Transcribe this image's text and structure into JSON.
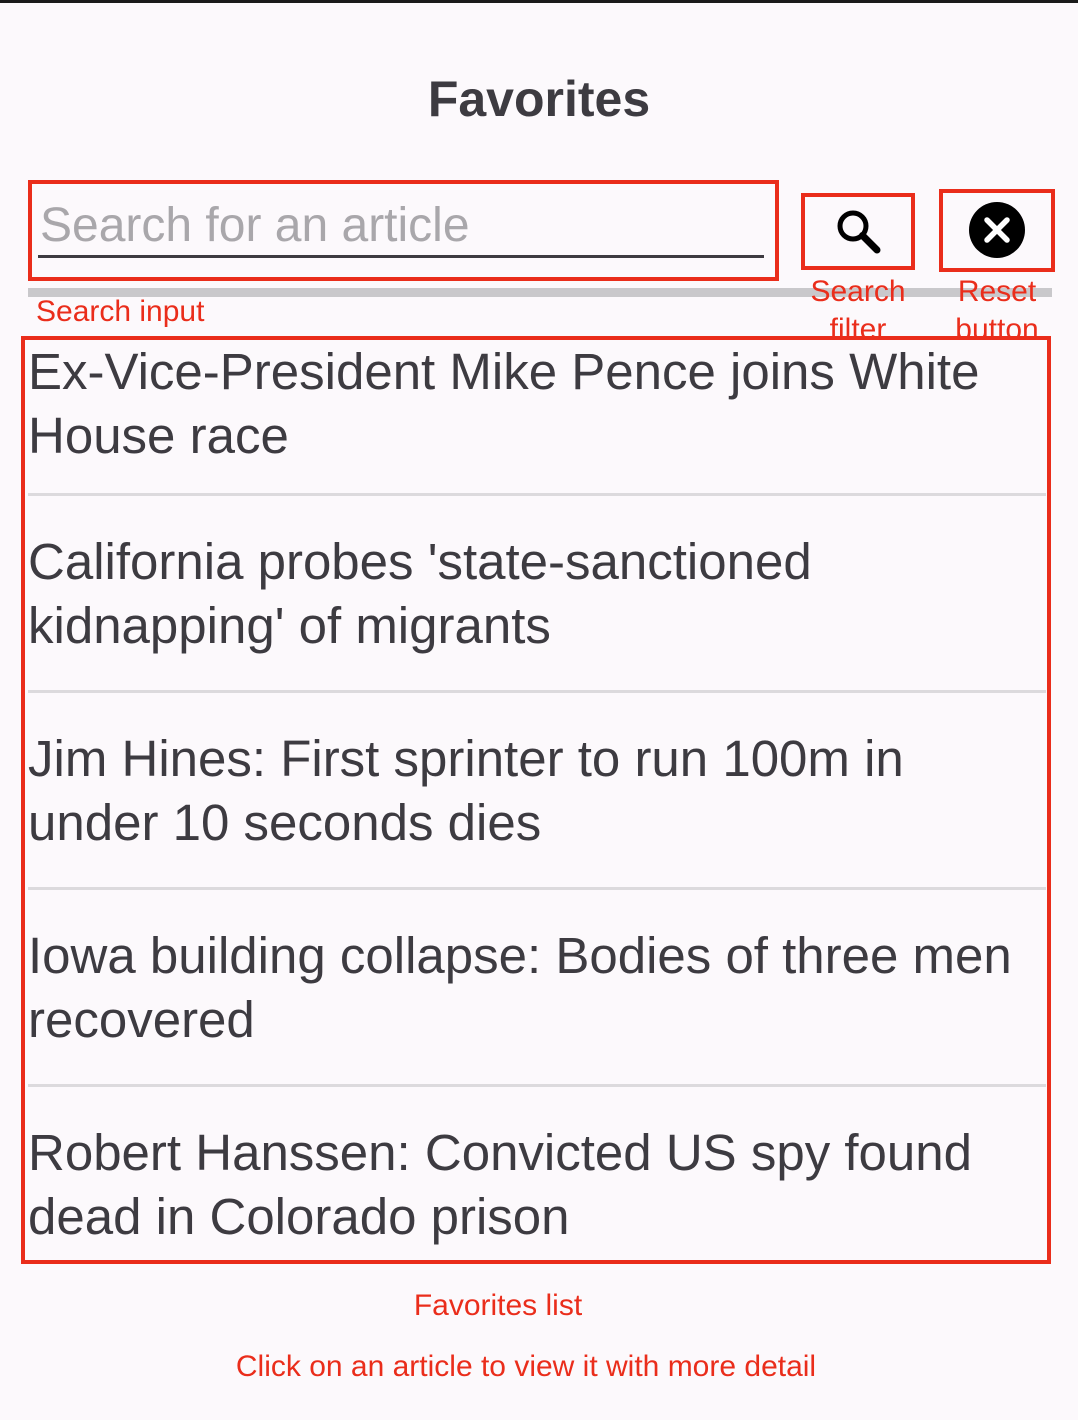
{
  "header": {
    "title": "Favorites"
  },
  "search": {
    "placeholder": "Search for an article",
    "value": ""
  },
  "icons": {
    "search_filter": "search-icon",
    "reset": "close-circle-icon"
  },
  "favorites": [
    {
      "title": "Ex-Vice-President Mike Pence joins White House race"
    },
    {
      "title": "California probes 'state-sanctioned kidnapping' of migrants"
    },
    {
      "title": "Jim Hines: First sprinter to run 100m in under 10 seconds dies"
    },
    {
      "title": "Iowa building collapse: Bodies of three men recovered"
    },
    {
      "title": "Robert Hanssen: Convicted US spy found dead in Colorado prison"
    }
  ],
  "annotations": {
    "search_input": "Search input",
    "search_filter_line1": "Search",
    "search_filter_line2": "filter",
    "reset_button_line1": "Reset",
    "reset_button_line2": "button",
    "favorites_list": "Favorites list",
    "hint": "Click on an article to view it with more detail"
  },
  "colors": {
    "annotation": "#ea2d1b",
    "background": "#fcf9fc",
    "text": "#3d3b41"
  }
}
